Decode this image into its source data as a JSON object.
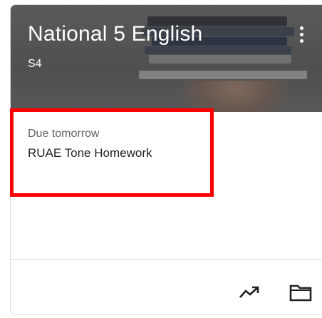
{
  "class_card": {
    "title": "National 5 English",
    "section": "S4",
    "due": {
      "label": "Due tomorrow",
      "assignment": "RUAE Tone Homework"
    },
    "icons": {
      "more": "more-vert-icon",
      "progress": "trending-up-icon",
      "folder": "folder-icon"
    }
  },
  "colors": {
    "highlight": "#ff0000",
    "header_bg": "#5f5f5f",
    "text_primary": "#202124",
    "text_secondary": "#5f6368"
  }
}
